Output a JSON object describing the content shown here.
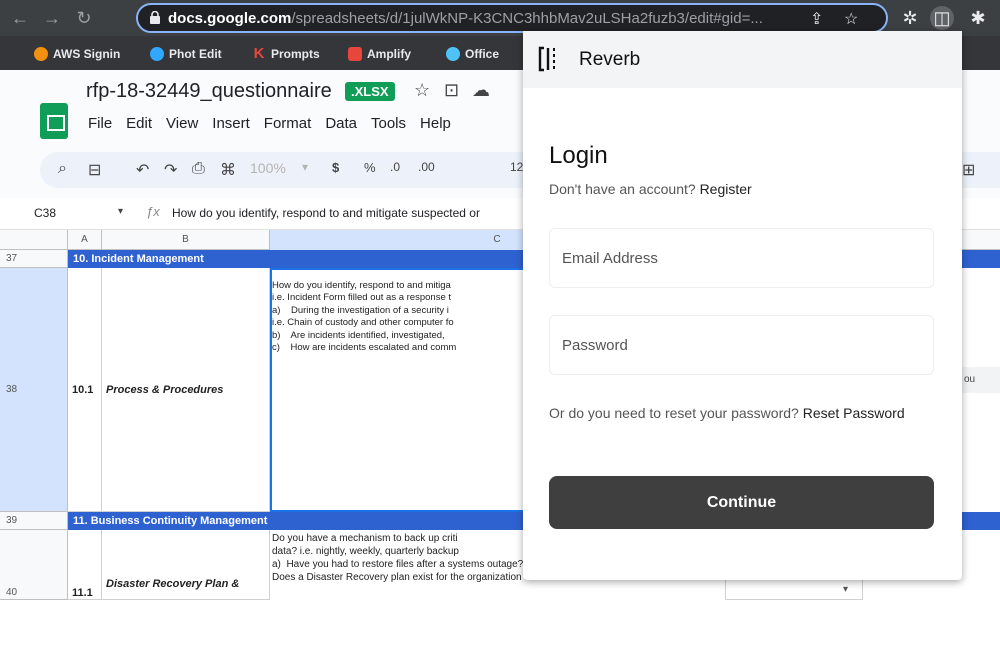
{
  "browser": {
    "url_host": "docs.google.com",
    "url_path": "/spreadsheets/d/1julWkNP-K3CNC3hhbMav2uLSHa2fuzb3/edit#gid=..."
  },
  "bookmarks": [
    {
      "label": "AWS Signin",
      "icon": "aws-icon",
      "color": "#f29111"
    },
    {
      "label": "Phot Edit",
      "icon": "photo-icon",
      "color": "#31a8ff"
    },
    {
      "label": "Prompts",
      "icon": "k-icon",
      "color": "#e8453c"
    },
    {
      "label": "Amplify",
      "icon": "amplify-icon",
      "color": "#e8453c"
    },
    {
      "label": "Office",
      "icon": "office-icon",
      "color": "#4fc3f7"
    }
  ],
  "sheet": {
    "title": "rfp-18-32449_questionnaire",
    "format_badge": ".XLSX",
    "menu": [
      "File",
      "Edit",
      "View",
      "Insert",
      "Format",
      "Data",
      "Tools",
      "Help"
    ],
    "toolbar": {
      "zoom": "100%",
      "currency": "$",
      "percent": "%",
      "dec_less": ".0",
      "dec_more": ".00",
      "font_size": "12"
    },
    "cell_ref": "C38",
    "formula": "How do you identify, respond to and mitigate suspected or",
    "columns": [
      "A",
      "B",
      "C"
    ],
    "rows": [
      {
        "num": "37",
        "section": "10. Incident Management"
      },
      {
        "num": "38",
        "id": "10.1",
        "label": "Process & Procedures",
        "text": "How do you identify, respond to and mitiga\ni.e. Incident Form filled out as a response t\na)    During the investigation of a security i\ni.e. Chain of custody and other computer fo\nb)    Are incidents identified, investigated,\nc)    How are incidents escalated and comm"
      },
      {
        "num": "39",
        "section": "11. Business Continuity Management"
      },
      {
        "num": "40",
        "id": "11.1",
        "label": "Disaster Recovery Plan &",
        "text": "Do you have a mechanism to back up criti\ndata? i.e. nightly, weekly, quarterly backup\na)  Have you had to restore files after a systems outage?\nDoes a Disaster Recovery plan exist for the organization and does it"
      }
    ],
    "right_cell_fragment": "ou"
  },
  "popup": {
    "app_name": "Reverb",
    "title": "Login",
    "no_account": "Don't have an account?",
    "register": "Register",
    "email_placeholder": "Email Address",
    "password_placeholder": "Password",
    "reset_prompt": "Or do you need to reset your password?",
    "reset_link": "Reset Password",
    "continue": "Continue"
  },
  "colors": {
    "accent": "#8ab4f8",
    "sheets_green": "#0f9d58",
    "section_blue": "#2f62d1",
    "button_dark": "#3f3f3f"
  }
}
